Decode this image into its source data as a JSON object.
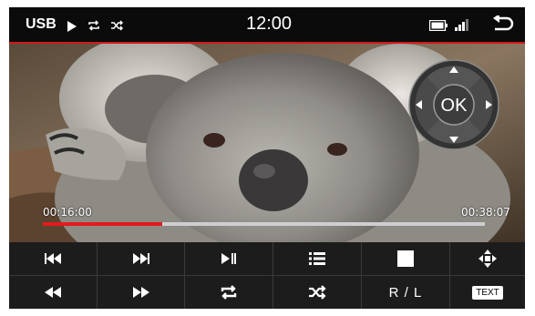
{
  "status": {
    "source": "USB",
    "time": "12:00",
    "icons": [
      "play-icon",
      "repeat-icon",
      "shuffle-icon",
      "battery-icon",
      "signal-icon",
      "back-icon"
    ]
  },
  "video": {
    "elapsed": "00:16:00",
    "duration": "00:38:07",
    "progress": 0.27
  },
  "dpad": {
    "ok_label": "OK"
  },
  "controls": {
    "row1": [
      "prev-track-icon",
      "next-track-icon",
      "play-pause-icon",
      "playlist-icon",
      "stop-icon",
      "move-icon"
    ],
    "row2": [
      "rewind-icon",
      "fast-forward-icon",
      "repeat-icon",
      "shuffle-icon",
      "R / L",
      "TEXT"
    ]
  }
}
